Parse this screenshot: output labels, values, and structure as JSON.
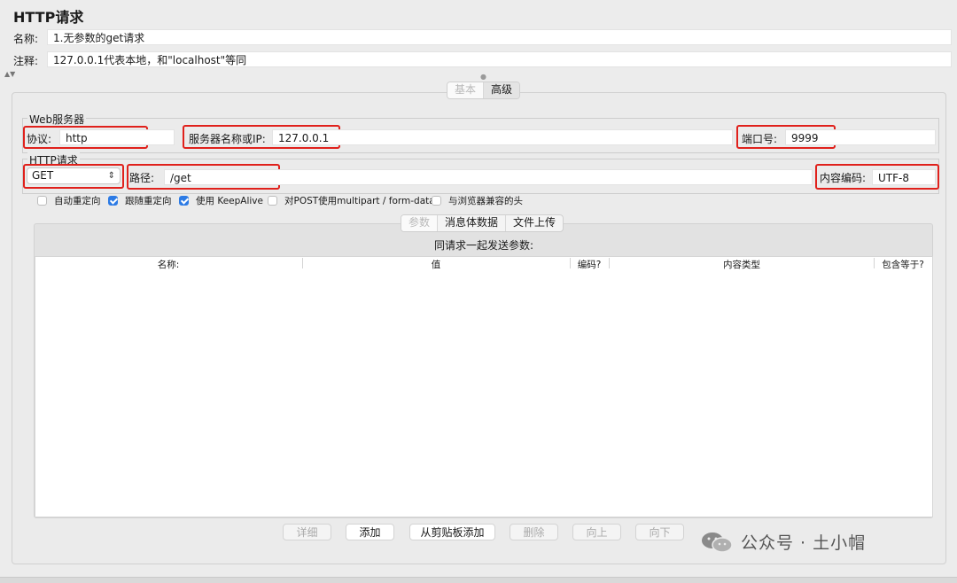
{
  "page": {
    "title": "HTTP请求"
  },
  "form": {
    "name_label": "名称:",
    "name_value": "1.无参数的get请求",
    "comment_label": "注释:",
    "comment_value": "127.0.0.1代表本地，和\"localhost\"等同"
  },
  "top_tabs": {
    "basic": "基本",
    "advanced": "高级"
  },
  "web_server": {
    "legend": "Web服务器",
    "protocol_label": "协议:",
    "protocol_value": "http",
    "server_label": "服务器名称或IP:",
    "server_value": "127.0.0.1",
    "port_label": "端口号:",
    "port_value": "9999"
  },
  "http_request": {
    "legend": "HTTP请求",
    "method": "GET",
    "path_label": "路径:",
    "path_value": "/get",
    "encoding_label": "内容编码:",
    "encoding_value": "UTF-8"
  },
  "options": [
    {
      "label": "自动重定向",
      "checked": false
    },
    {
      "label": "跟随重定向",
      "checked": true
    },
    {
      "label": "使用 KeepAlive",
      "checked": true
    },
    {
      "label": "对POST使用multipart / form-data",
      "checked": false
    },
    {
      "label": "与浏览器兼容的头",
      "checked": false
    }
  ],
  "inner_tabs": {
    "params": "参数",
    "body": "消息体数据",
    "upload": "文件上传"
  },
  "params_table": {
    "caption": "同请求一起发送参数:",
    "columns": [
      "名称:",
      "值",
      "编码?",
      "内容类型",
      "包含等于?"
    ]
  },
  "buttons": {
    "detail": "详细",
    "add": "添加",
    "add_clipboard": "从剪贴板添加",
    "delete": "删除",
    "up": "向上",
    "down": "向下"
  },
  "watermark": {
    "text": "公众号 · 土小帽"
  }
}
